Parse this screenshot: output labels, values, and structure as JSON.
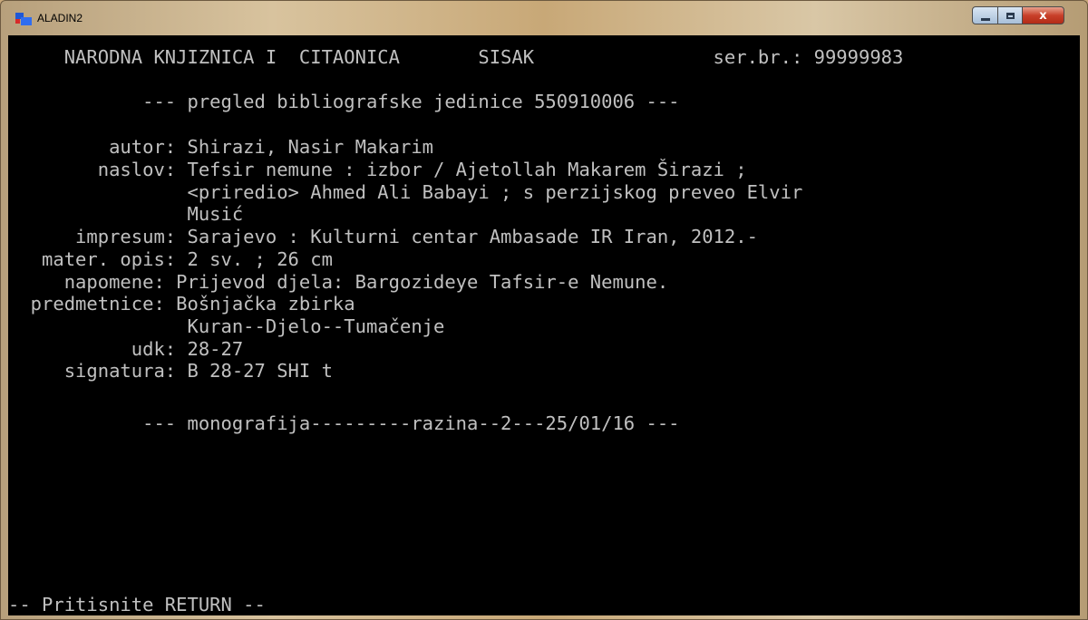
{
  "window": {
    "title": "ALADIN2",
    "controls": {
      "minimize": "minimize",
      "maximize": "maximize",
      "close": "x"
    }
  },
  "terminal": {
    "lines": [
      "     NARODNA KNJIZNICA I  CITAONICA       SISAK                ser.br.: 99999983",
      "",
      "            --- pregled bibliografske jedinice 550910006 ---",
      "",
      "         autor: Shirazi, Nasir Makarim",
      "        naslov: Tefsir nemune : izbor / Ajetollah Makarem Širazi ;",
      "                <priredio> Ahmed Ali Babayi ; s perzijskog preveo Elvir",
      "                Musić",
      "      impresum: Sarajevo : Kulturni centar Ambasade IR Iran, 2012.-",
      "   mater. opis: 2 sv. ; 26 cm",
      "     napomene: Prijevod djela: Bargozideye Tafsir-e Nemune.",
      "  predmetnice: Bošnjačka zbirka",
      "                Kuran--Djelo--Tumačenje",
      "           udk: 28-27",
      "     signatura: B 28-27 SHI t",
      "",
      "            --- monografija---------razina--2---25/01/16 ---"
    ],
    "prompt": "-- Pritisnite RETURN --"
  }
}
